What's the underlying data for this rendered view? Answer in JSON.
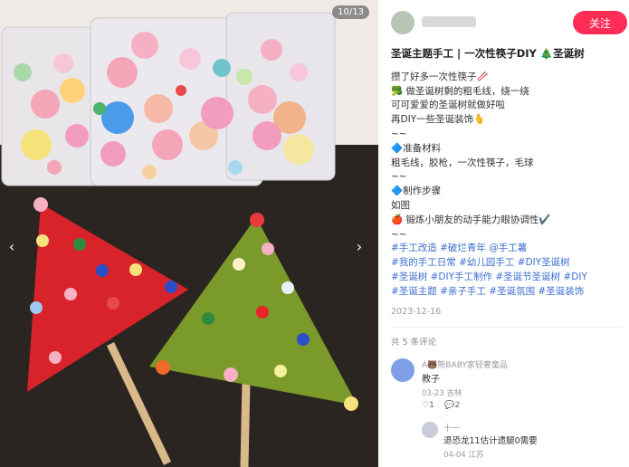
{
  "image": {
    "counter": "10/13",
    "prev_glyph": "‹",
    "next_glyph": "›"
  },
  "author": {
    "name": "",
    "follow_label": "关注"
  },
  "post": {
    "title": "圣诞主题手工 | 一次性筷子DIY 🎄圣诞树",
    "lines": [
      "攒了好多一次性筷子🥢",
      "🥦 做圣诞树剩的粗毛线，绕一绕",
      "可可爱爱的圣诞树就做好啦",
      "再DIY一些圣诞装饰🫰",
      "~~",
      "🔷准备材料",
      "粗毛线，胶枪，一次性筷子，毛球",
      "~~",
      "🔷制作步骤",
      "如图",
      "🍎 锻炼小朋友的动手能力眼协调性✔️",
      "~~"
    ],
    "tags": [
      "#手工改造 #破烂青年 @手工薯",
      "#我的手工日常 #幼儿园手工 #DIY圣诞树",
      "#圣诞树 #DIY手工制作 #圣诞节圣诞树 #DIY",
      "#圣诞主题 #亲子手工 #圣诞氛围 #圣诞装饰"
    ],
    "date": "2023-12-16"
  },
  "comments_count": "共 5 条评论",
  "comment": {
    "name": "A🐻熊BABY家轻奢童品",
    "text": "教子",
    "meta": "03-23 吉林",
    "likes": "♡1",
    "replies": "💬2"
  },
  "reply": {
    "name": "十一",
    "text": "退恐龙11估计遗腿0需要",
    "meta": "04-04 江苏"
  },
  "colors": {
    "follow": "#ff2d55",
    "tag": "#3d6fd1",
    "red_tree": "#d8232a",
    "green_tree": "#7a9a2a"
  }
}
